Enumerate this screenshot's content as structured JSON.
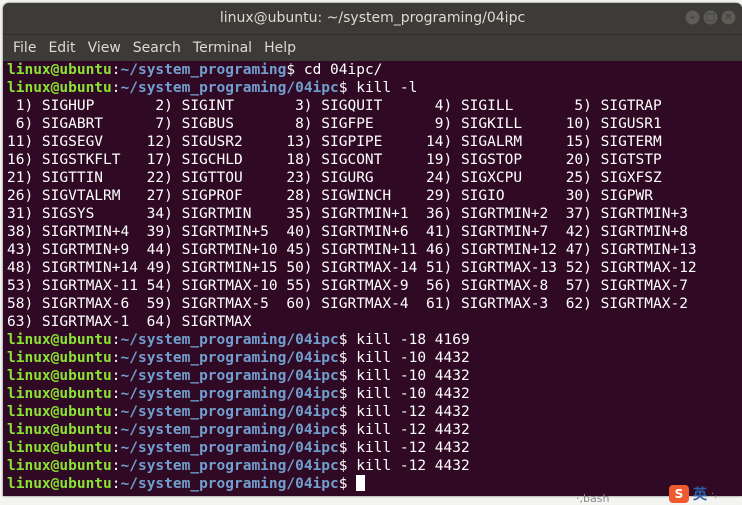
{
  "window": {
    "title": "linux@ubuntu: ~/system_programing/04ipc"
  },
  "window_controls": {
    "minimize": "–",
    "maximize": "□",
    "close": "✕"
  },
  "menu": [
    "File",
    "Edit",
    "View",
    "Search",
    "Terminal",
    "Help"
  ],
  "prompt": {
    "user": "linux@ubuntu",
    "sep": ":"
  },
  "terminal_lines": [
    {
      "type": "prompt",
      "path": "~/system_programing",
      "cmd": "$ cd 04ipc/"
    },
    {
      "type": "prompt",
      "path": "~/system_programing/04ipc",
      "cmd": "$ kill -l"
    },
    {
      "type": "out",
      "text": " 1) SIGHUP       2) SIGINT       3) SIGQUIT      4) SIGILL       5) SIGTRAP"
    },
    {
      "type": "out",
      "text": " 6) SIGABRT      7) SIGBUS       8) SIGFPE       9) SIGKILL     10) SIGUSR1"
    },
    {
      "type": "out",
      "text": "11) SIGSEGV     12) SIGUSR2     13) SIGPIPE     14) SIGALRM     15) SIGTERM"
    },
    {
      "type": "out",
      "text": "16) SIGSTKFLT   17) SIGCHLD     18) SIGCONT     19) SIGSTOP     20) SIGTSTP"
    },
    {
      "type": "out",
      "text": "21) SIGTTIN     22) SIGTTOU     23) SIGURG      24) SIGXCPU     25) SIGXFSZ"
    },
    {
      "type": "out",
      "text": "26) SIGVTALRM   27) SIGPROF     28) SIGWINCH    29) SIGIO       30) SIGPWR"
    },
    {
      "type": "out",
      "text": "31) SIGSYS      34) SIGRTMIN    35) SIGRTMIN+1  36) SIGRTMIN+2  37) SIGRTMIN+3"
    },
    {
      "type": "out",
      "text": "38) SIGRTMIN+4  39) SIGRTMIN+5  40) SIGRTMIN+6  41) SIGRTMIN+7  42) SIGRTMIN+8"
    },
    {
      "type": "out",
      "text": "43) SIGRTMIN+9  44) SIGRTMIN+10 45) SIGRTMIN+11 46) SIGRTMIN+12 47) SIGRTMIN+13"
    },
    {
      "type": "out",
      "text": "48) SIGRTMIN+14 49) SIGRTMIN+15 50) SIGRTMAX-14 51) SIGRTMAX-13 52) SIGRTMAX-12"
    },
    {
      "type": "out",
      "text": "53) SIGRTMAX-11 54) SIGRTMAX-10 55) SIGRTMAX-9  56) SIGRTMAX-8  57) SIGRTMAX-7"
    },
    {
      "type": "out",
      "text": "58) SIGRTMAX-6  59) SIGRTMAX-5  60) SIGRTMAX-4  61) SIGRTMAX-3  62) SIGRTMAX-2"
    },
    {
      "type": "out",
      "text": "63) SIGRTMAX-1  64) SIGRTMAX"
    },
    {
      "type": "prompt",
      "path": "~/system_programing/04ipc",
      "cmd": "$ kill -18 4169"
    },
    {
      "type": "prompt",
      "path": "~/system_programing/04ipc",
      "cmd": "$ kill -10 4432"
    },
    {
      "type": "prompt",
      "path": "~/system_programing/04ipc",
      "cmd": "$ kill -10 4432"
    },
    {
      "type": "prompt",
      "path": "~/system_programing/04ipc",
      "cmd": "$ kill -10 4432"
    },
    {
      "type": "prompt",
      "path": "~/system_programing/04ipc",
      "cmd": "$ kill -12 4432"
    },
    {
      "type": "prompt",
      "path": "~/system_programing/04ipc",
      "cmd": "$ kill -12 4432"
    },
    {
      "type": "prompt",
      "path": "~/system_programing/04ipc",
      "cmd": "$ kill -12 4432"
    },
    {
      "type": "prompt",
      "path": "~/system_programing/04ipc",
      "cmd": "$ kill -12 4432"
    },
    {
      "type": "prompt",
      "path": "~/system_programing/04ipc",
      "cmd": "$ ",
      "cursor": true
    }
  ],
  "tray": {
    "ime_logo": "S",
    "ime_label": "英",
    "ime_extra": "·,",
    "tail_text": "·,bash"
  },
  "colors": {
    "terminal_bg": "#300a24",
    "user_green": "#8ae234",
    "path_blue": "#729fcf",
    "titlebar": "#3c3b37"
  }
}
